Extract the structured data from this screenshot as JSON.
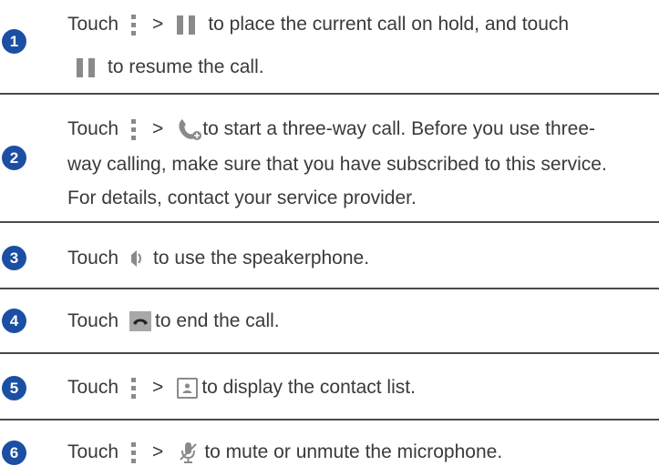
{
  "items": [
    {
      "num": "1",
      "lines": [
        {
          "before": "Touch",
          "sep": ">",
          "after": "to place the current call on hold, and touch"
        },
        {
          "after": "to resume the call."
        }
      ]
    },
    {
      "num": "2",
      "lines": [
        {
          "before": "Touch",
          "sep": ">",
          "after": "to start a three-way call. Before you use three-"
        },
        {
          "text": "way calling, make sure that you have subscribed to this service."
        },
        {
          "text": "For details, contact your service provider."
        }
      ]
    },
    {
      "num": "3",
      "line": {
        "before": "Touch",
        "after": "to use the speakerphone."
      }
    },
    {
      "num": "4",
      "line": {
        "before": "Touch",
        "after": "to end the call."
      }
    },
    {
      "num": "5",
      "line": {
        "before": "Touch",
        "sep": ">",
        "after": "to display the contact list."
      }
    },
    {
      "num": "6",
      "line": {
        "before": "Touch",
        "sep": ">",
        "after": "to mute or unmute the microphone."
      }
    }
  ],
  "icons": {
    "menu": "menu-icon",
    "hold": "pause-icon",
    "add_call": "add-call-icon",
    "speaker": "speaker-icon",
    "end_call": "end-call-icon",
    "contacts": "contacts-icon",
    "mute": "mute-microphone-icon"
  },
  "colors": {
    "number_badge": "#1b4fa3",
    "text": "#3a3a3a",
    "icon": "#8a8a8a",
    "divider": "#4a4a4a"
  }
}
